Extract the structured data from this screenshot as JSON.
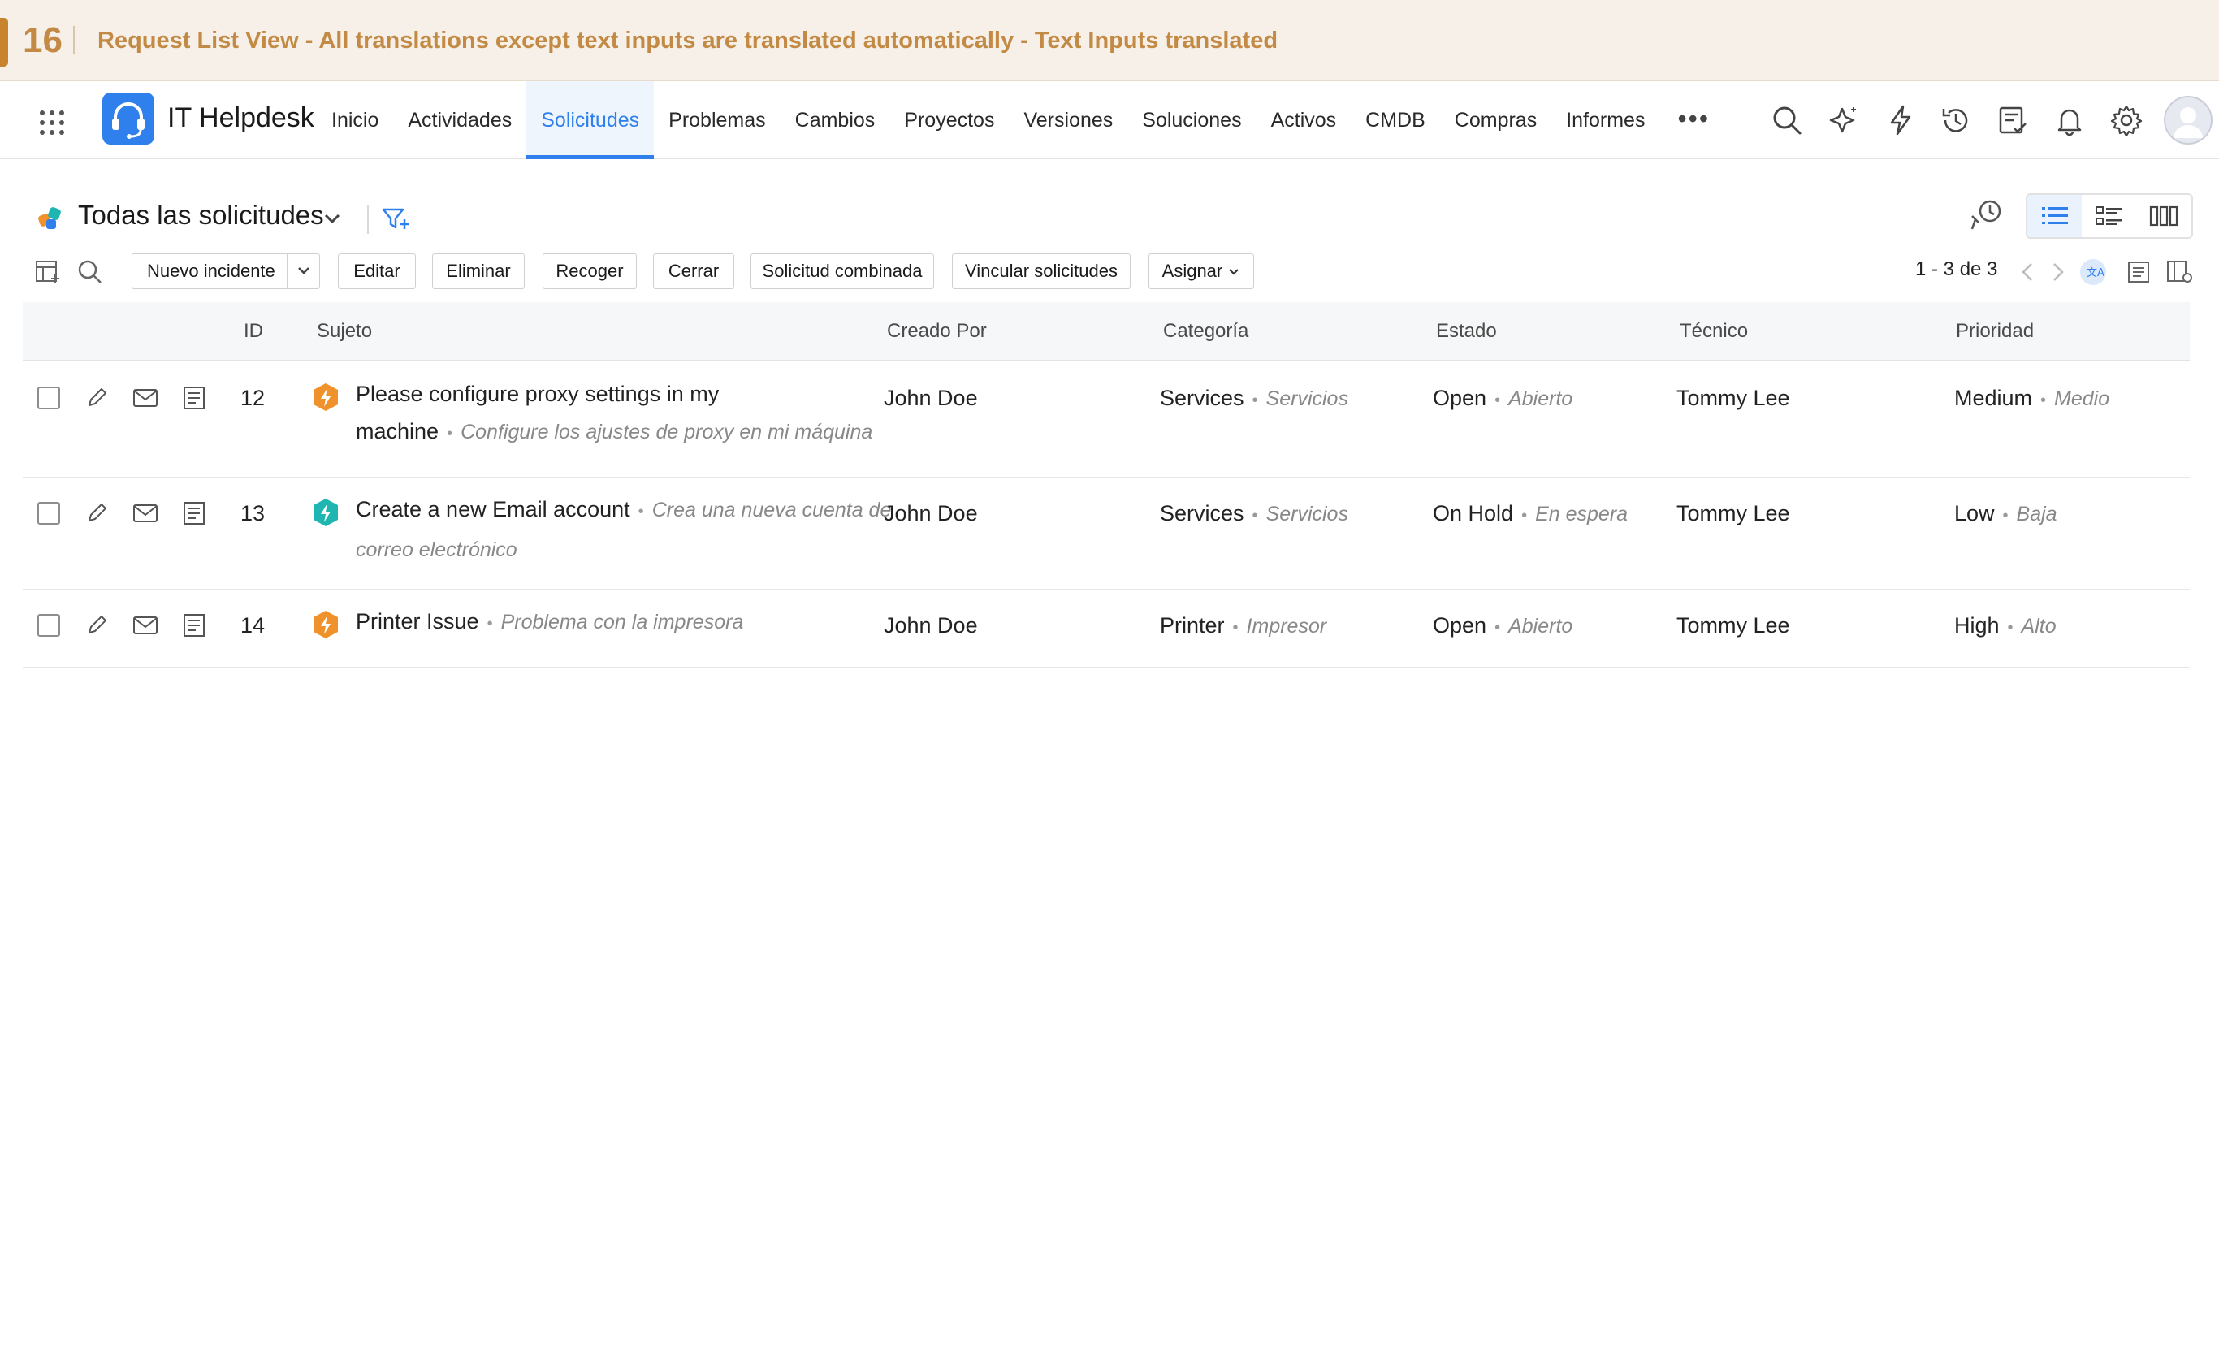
{
  "banner": {
    "step": "16",
    "title": "Request List View - All translations except text inputs are translated automatically  - Text Inputs translated"
  },
  "app": {
    "name": "IT Helpdesk"
  },
  "nav": {
    "tabs": [
      "Inicio",
      "Actividades",
      "Solicitudes",
      "Problemas",
      "Cambios",
      "Proyectos",
      "Versiones",
      "Soluciones",
      "Activos",
      "CMDB",
      "Compras",
      "Informes"
    ],
    "active_tab": "Solicitudes",
    "more": "•••",
    "icons": [
      "search-icon",
      "ai-sparkle-icon",
      "lightning-icon",
      "history-icon",
      "checklist-icon",
      "bell-icon",
      "gear-icon",
      "avatar"
    ]
  },
  "view": {
    "title": "Todas las solicitudes",
    "icons": [
      "view-selector-icon",
      "chevron-down-icon",
      "filter-add-icon",
      "reminder-icon"
    ],
    "layouts": [
      "list-view-icon",
      "card-list-view-icon",
      "column-view-icon"
    ],
    "active_layout": "list-view-icon"
  },
  "toolbar": {
    "new_incident": "Nuevo incidente",
    "edit": "Editar",
    "delete": "Eliminar",
    "pickup": "Recoger",
    "close": "Cerrar",
    "merge": "Solicitud combinada",
    "link": "Vincular solicitudes",
    "assign": "Asignar",
    "pagination": "1 - 3 de 3"
  },
  "table": {
    "headers": {
      "id": "ID",
      "subject": "Sujeto",
      "created_by": "Creado Por",
      "category": "Categoría",
      "status": "Estado",
      "technician": "Técnico",
      "priority": "Prioridad"
    },
    "rows": [
      {
        "id": "12",
        "type_color": "#f0922b",
        "subject": "Please configure proxy settings in my machine",
        "subject_tr": "Configure los ajustes de proxy en mi máquina",
        "created_by": "John Doe",
        "category": "Services",
        "category_tr": "Servicios",
        "status": "Open",
        "status_tr": "Abierto",
        "technician": "Tommy Lee",
        "priority": "Medium",
        "priority_tr": "Medio"
      },
      {
        "id": "13",
        "type_color": "#1fb5b0",
        "subject": "Create a new Email account",
        "subject_tr": "Crea una nueva cuenta de correo electrónico",
        "created_by": "John Doe",
        "category": "Services",
        "category_tr": "Servicios",
        "status": "On Hold",
        "status_tr": "En espera",
        "technician": "Tommy Lee",
        "priority": "Low",
        "priority_tr": "Baja"
      },
      {
        "id": "14",
        "type_color": "#f0922b",
        "subject": "Printer Issue",
        "subject_tr": "Problema con la impresora",
        "created_by": "John Doe",
        "category": "Printer",
        "category_tr": "Impresor",
        "status": "Open",
        "status_tr": "Abierto",
        "technician": "Tommy Lee",
        "priority": "High",
        "priority_tr": "Alto"
      }
    ]
  }
}
